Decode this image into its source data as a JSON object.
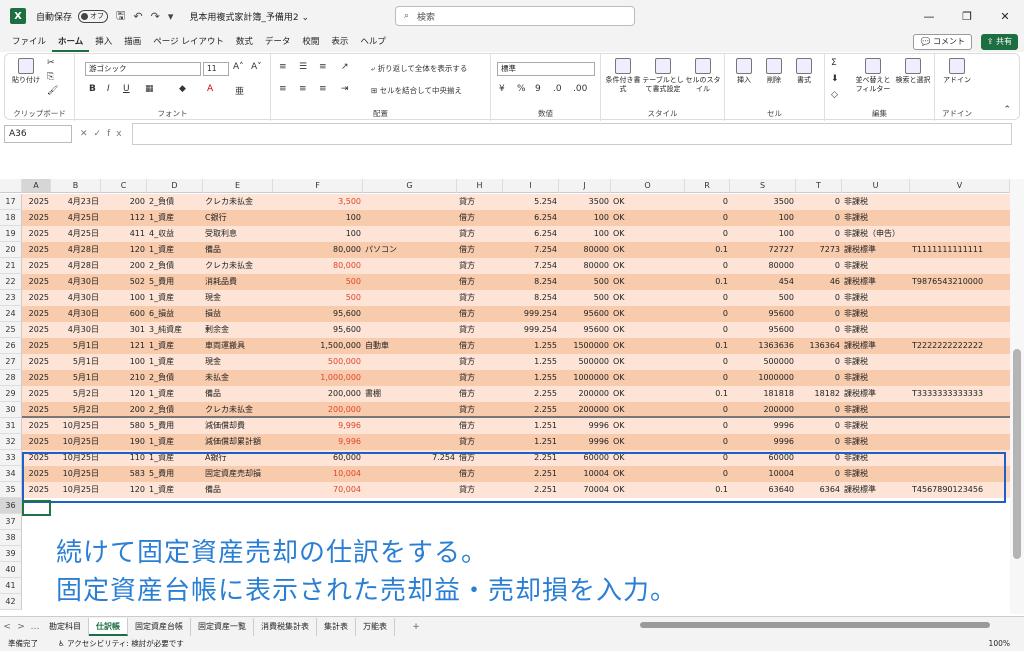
{
  "titlebar": {
    "autosave_label": "自動保存",
    "autosave_state": "オフ",
    "doc_title": "見本用複式家計簿_予備用2 ⌄",
    "search_placeholder": "検索"
  },
  "menu": [
    "ファイル",
    "ホーム",
    "挿入",
    "描画",
    "ページ レイアウト",
    "数式",
    "データ",
    "校閲",
    "表示",
    "ヘルプ"
  ],
  "menu_active": "ホーム",
  "comment_label": "コメント",
  "share_label": "共有",
  "ribbon": {
    "paste": "貼り付け",
    "clipboard": "クリップボード",
    "font_name": "游ゴシック",
    "font_size": "11",
    "font": "フォント",
    "wrap": "折り返して全体を表示する",
    "merge": "セルを結合して中央揃え",
    "align": "配置",
    "number_format": "標準",
    "number": "数値",
    "cond_format": "条件付き書式",
    "table_format": "テーブルとして書式設定",
    "cell_style": "セルのスタイル",
    "style": "スタイル",
    "insert": "挿入",
    "delete": "削除",
    "format": "書式",
    "cells": "セル",
    "sort_filter": "並べ替えとフィルター",
    "find_select": "検索と選択",
    "edit": "編集",
    "addin": "アドイン",
    "addin_group": "アドイン"
  },
  "name_box": "A36",
  "columns": [
    "A",
    "B",
    "C",
    "D",
    "E",
    "F",
    "G",
    "H",
    "I",
    "J",
    "O",
    "R",
    "S",
    "T",
    "U",
    "V"
  ],
  "rows": [
    {
      "n": "17",
      "a": "2025",
      "b": "4月23日",
      "c": "200",
      "d": "2_負債",
      "e": "クレカ未払金",
      "f": "3,500",
      "fred": true,
      "g": "",
      "h": "貸方",
      "i": "5.254",
      "j": "3500",
      "o": "OK",
      "r": "0",
      "s": "3500",
      "t": "0",
      "u": "非課税",
      "v": ""
    },
    {
      "n": "18",
      "a": "2025",
      "b": "4月25日",
      "c": "112",
      "d": "1_資産",
      "e": "C銀行",
      "f": "100",
      "fred": false,
      "g": "",
      "h": "借方",
      "i": "6.254",
      "j": "100",
      "o": "OK",
      "r": "0",
      "s": "100",
      "t": "0",
      "u": "非課税",
      "v": ""
    },
    {
      "n": "19",
      "a": "2025",
      "b": "4月25日",
      "c": "411",
      "d": "4_収益",
      "e": "受取利息",
      "f": "100",
      "fred": false,
      "g": "",
      "h": "貸方",
      "i": "6.254",
      "j": "100",
      "o": "OK",
      "r": "0",
      "s": "100",
      "t": "0",
      "u": "非課税（申告）",
      "v": ""
    },
    {
      "n": "20",
      "a": "2025",
      "b": "4月28日",
      "c": "120",
      "d": "1_資産",
      "e": "備品",
      "f": "80,000",
      "fred": false,
      "g": "パソコン",
      "h": "借方",
      "i": "7.254",
      "j": "80000",
      "o": "OK",
      "r": "0.1",
      "s": "72727",
      "t": "7273",
      "u": "課税標準",
      "v": "T1111111111111"
    },
    {
      "n": "21",
      "a": "2025",
      "b": "4月28日",
      "c": "200",
      "d": "2_負債",
      "e": "クレカ未払金",
      "f": "80,000",
      "fred": true,
      "g": "",
      "h": "貸方",
      "i": "7.254",
      "j": "80000",
      "o": "OK",
      "r": "0",
      "s": "80000",
      "t": "0",
      "u": "非課税",
      "v": ""
    },
    {
      "n": "22",
      "a": "2025",
      "b": "4月30日",
      "c": "502",
      "d": "5_費用",
      "e": "消耗品費",
      "f": "500",
      "fred": true,
      "g": "",
      "h": "借方",
      "i": "8.254",
      "j": "500",
      "o": "OK",
      "r": "0.1",
      "s": "454",
      "t": "46",
      "u": "課税標準",
      "v": "T9876543210000"
    },
    {
      "n": "23",
      "a": "2025",
      "b": "4月30日",
      "c": "100",
      "d": "1_資産",
      "e": "現金",
      "f": "500",
      "fred": true,
      "g": "",
      "h": "貸方",
      "i": "8.254",
      "j": "500",
      "o": "OK",
      "r": "0",
      "s": "500",
      "t": "0",
      "u": "非課税",
      "v": ""
    },
    {
      "n": "24",
      "a": "2025",
      "b": "4月30日",
      "c": "600",
      "d": "6_損益",
      "e": "損益",
      "f": "95,600",
      "fred": false,
      "g": "",
      "h": "借方",
      "i": "999.254",
      "j": "95600",
      "o": "OK",
      "r": "0",
      "s": "95600",
      "t": "0",
      "u": "非課税",
      "v": ""
    },
    {
      "n": "25",
      "a": "2025",
      "b": "4月30日",
      "c": "301",
      "d": "3_純資産",
      "e": "剰余金",
      "f": "95,600",
      "fred": false,
      "g": "",
      "h": "貸方",
      "i": "999.254",
      "j": "95600",
      "o": "OK",
      "r": "0",
      "s": "95600",
      "t": "0",
      "u": "非課税",
      "v": ""
    },
    {
      "n": "26",
      "a": "2025",
      "b": "5月1日",
      "c": "121",
      "d": "1_資産",
      "e": "車両運搬具",
      "f": "1,500,000",
      "fred": false,
      "g": "自動車",
      "h": "借方",
      "i": "1.255",
      "j": "1500000",
      "o": "OK",
      "r": "0.1",
      "s": "1363636",
      "t": "136364",
      "u": "課税標準",
      "v": "T2222222222222"
    },
    {
      "n": "27",
      "a": "2025",
      "b": "5月1日",
      "c": "100",
      "d": "1_資産",
      "e": "現金",
      "f": "500,000",
      "fred": true,
      "g": "",
      "h": "貸方",
      "i": "1.255",
      "j": "500000",
      "o": "OK",
      "r": "0",
      "s": "500000",
      "t": "0",
      "u": "非課税",
      "v": ""
    },
    {
      "n": "28",
      "a": "2025",
      "b": "5月1日",
      "c": "210",
      "d": "2_負債",
      "e": "未払金",
      "f": "1,000,000",
      "fred": true,
      "g": "",
      "h": "貸方",
      "i": "1.255",
      "j": "1000000",
      "o": "OK",
      "r": "0",
      "s": "1000000",
      "t": "0",
      "u": "非課税",
      "v": ""
    },
    {
      "n": "29",
      "a": "2025",
      "b": "5月2日",
      "c": "120",
      "d": "1_資産",
      "e": "備品",
      "f": "200,000",
      "fred": false,
      "g": "書棚",
      "h": "借方",
      "i": "2.255",
      "j": "200000",
      "o": "OK",
      "r": "0.1",
      "s": "181818",
      "t": "18182",
      "u": "課税標準",
      "v": "T3333333333333"
    },
    {
      "n": "30",
      "a": "2025",
      "b": "5月2日",
      "c": "200",
      "d": "2_負債",
      "e": "クレカ未払金",
      "f": "200,000",
      "fred": true,
      "g": "",
      "h": "貸方",
      "i": "2.255",
      "j": "200000",
      "o": "OK",
      "r": "0",
      "s": "200000",
      "t": "0",
      "u": "非課税",
      "v": ""
    },
    {
      "n": "31",
      "a": "2025",
      "b": "10月25日",
      "c": "580",
      "d": "5_費用",
      "e": "減価償却費",
      "f": "9,996",
      "fred": true,
      "g": "",
      "h": "借方",
      "i": "1.251",
      "j": "9996",
      "o": "OK",
      "r": "0",
      "s": "9996",
      "t": "0",
      "u": "非課税",
      "v": ""
    },
    {
      "n": "32",
      "a": "2025",
      "b": "10月25日",
      "c": "190",
      "d": "1_資産",
      "e": "減価償却累計額",
      "f": "9,996",
      "fred": true,
      "g": "",
      "h": "貸方",
      "i": "1.251",
      "j": "9996",
      "o": "OK",
      "r": "0",
      "s": "9996",
      "t": "0",
      "u": "非課税",
      "v": ""
    },
    {
      "n": "33",
      "a": "2025",
      "b": "10月25日",
      "c": "110",
      "d": "1_資産",
      "e": "A銀行",
      "f": "60,000",
      "fred": false,
      "g": "7.254",
      "h": "借方",
      "i": "2.251",
      "j": "60000",
      "o": "OK",
      "r": "0",
      "s": "60000",
      "t": "0",
      "u": "非課税",
      "v": ""
    },
    {
      "n": "34",
      "a": "2025",
      "b": "10月25日",
      "c": "583",
      "d": "5_費用",
      "e": "固定資産売却損",
      "f": "10,004",
      "fred": true,
      "g": "",
      "h": "借方",
      "i": "2.251",
      "j": "10004",
      "o": "OK",
      "r": "0",
      "s": "10004",
      "t": "0",
      "u": "非課税",
      "v": ""
    },
    {
      "n": "35",
      "a": "2025",
      "b": "10月25日",
      "c": "120",
      "d": "1_資産",
      "e": "備品",
      "f": "70,004",
      "fred": true,
      "g": "",
      "h": "貸方",
      "i": "2.251",
      "j": "70004",
      "o": "OK",
      "r": "0.1",
      "s": "63640",
      "t": "6364",
      "u": "課税標準",
      "v": "T4567890123456"
    }
  ],
  "empty_rows": [
    "36",
    "37",
    "38",
    "39",
    "40",
    "41",
    "42"
  ],
  "overlay": {
    "line1": "続けて固定資産売却の仕訳をする。",
    "line2": "固定資産台帳に表示された売却益・売却損を入力。"
  },
  "sheet_tabs": [
    "勘定科目",
    "仕訳帳",
    "固定資産台帳",
    "固定資産一覧",
    "消費税集計表",
    "集計表",
    "万能表"
  ],
  "sheet_active": "仕訳帳",
  "status": {
    "ready": "準備完了",
    "accessibility": "アクセシビリティ: 検討が必要です",
    "zoom": "100%"
  },
  "colors": {
    "row_light": "#fde4d6",
    "row_dark": "#f8cbad",
    "accent": "#1d6f42",
    "highlight": "#1f5fc8",
    "overlay": "#2a7fd4"
  }
}
